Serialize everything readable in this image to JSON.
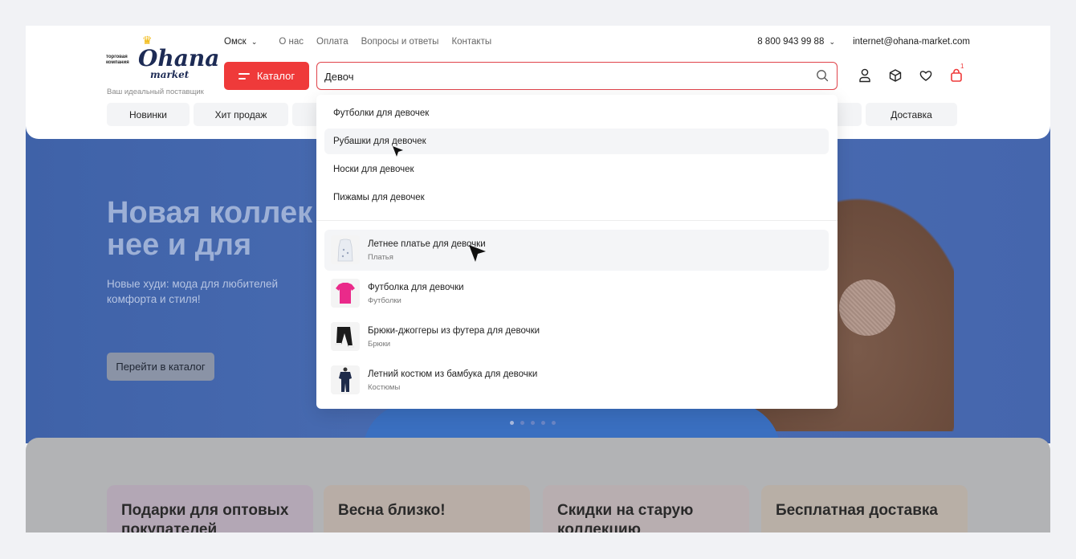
{
  "header": {
    "logo": {
      "small_text": "торговая компания",
      "name": "Ohana",
      "sub": "market",
      "tagline": "Ваш идеальный поставщик"
    },
    "city": "Омск",
    "nav_links": [
      "О нас",
      "Оплата",
      "Вопросы и ответы",
      "Контакты"
    ],
    "phone": "8 800 943 99 88",
    "email": "internet@ohana-market.com",
    "catalog_label": "Каталог",
    "search": {
      "value": "Девоч"
    },
    "cart_count": "1",
    "categories": [
      "Новинки",
      "Хит продаж",
      "",
      "ды",
      "Доставка"
    ]
  },
  "dropdown": {
    "suggestions": [
      "Футболки для девочек",
      "Рубашки для девочек",
      "Носки для девочек",
      "Пижамы для девочек"
    ],
    "products": [
      {
        "name": "Летнее платье для девочки",
        "category": "Платья"
      },
      {
        "name": "Футболка для девочки",
        "category": "Футболки"
      },
      {
        "name": "Брюки-джоггеры из футера для девочки",
        "category": "Брюки"
      },
      {
        "name": "Летний костюм из бамбука для девочки",
        "category": "Костюмы"
      }
    ]
  },
  "hero": {
    "title": "Новая коллек для нее и для",
    "subtitle": "Новые худи: мода для любителей комфорта и стиля!",
    "button": "Перейти в каталог"
  },
  "promos": [
    "Подарки для оптовых покупателей",
    "Весна близко!",
    "Скидки на старую коллекцию",
    "Бесплатная доставка"
  ],
  "colors": {
    "accent": "#ef3a3a",
    "hero": "#4566ad",
    "logo": "#1d2b55"
  }
}
